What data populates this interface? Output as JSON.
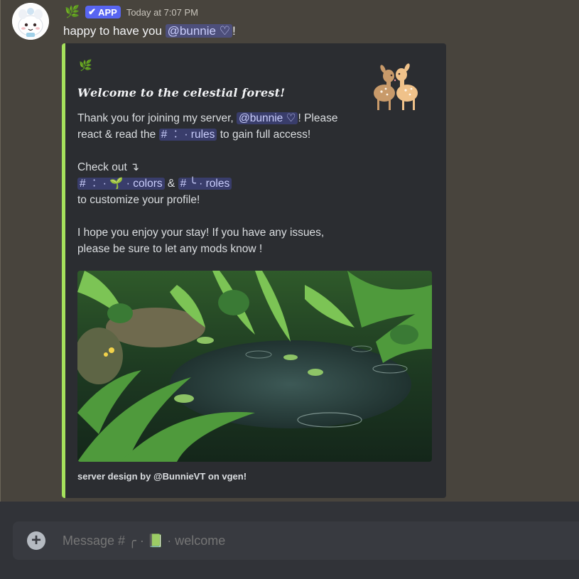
{
  "message": {
    "author_icon": "🌿",
    "badge": {
      "check": "✔",
      "label": "APP"
    },
    "timestamp": "Today at 7:07 PM",
    "content_prefix": "happy to have you ",
    "mention": "@bunnie ♡",
    "content_suffix": "!"
  },
  "embed": {
    "accent_color": "#a5e15c",
    "author_icon": "🌿",
    "title": "𝑾𝒆𝒍𝒄𝒐𝒎𝒆 𝒕𝒐 𝒕𝒉𝒆 𝒄𝒆𝒍𝒆𝒔𝒕𝒊𝒂𝒍 𝒇𝒐𝒓𝒆𝒔𝒕!",
    "line1_a": "Thank you for joining my server, ",
    "line1_mention": "@bunnie ♡",
    "line1_b": "! Please",
    "line2_a": "react & read the ",
    "line2_channel": "# ︰ · rules",
    "line2_b": " to gain full access!",
    "line3": "Check out ↴",
    "channel_colors": "# ︰ · 🌱 · colors",
    "amp": " & ",
    "channel_roles": "# ╰ · roles",
    "line5": "to customize your profile!",
    "line6": "I hope you enjoy your stay! If you have any issues,",
    "line7": "please be sure to let any mods know !",
    "footer": "server design by @BunnieVT on vgen!"
  },
  "composer": {
    "placeholder": "Message # ╭ · 📗 · welcome",
    "add_icon": "+"
  }
}
